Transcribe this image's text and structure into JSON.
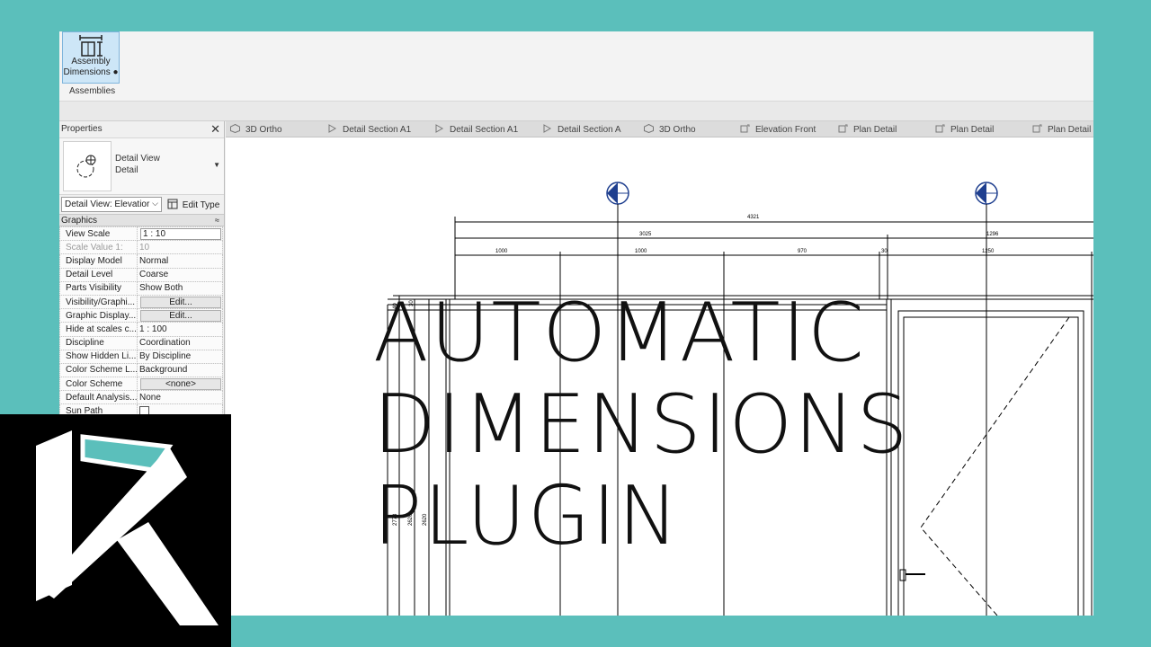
{
  "ribbon": {
    "button_line1": "Assembly",
    "button_line2": "Dimensions ●",
    "group_label": "Assemblies"
  },
  "properties": {
    "title": "Properties",
    "close": "✕",
    "type_line1": "Detail View",
    "type_line2": "Detail",
    "instance_select": "Detail View: Elevatior",
    "edit_type": "Edit Type",
    "category": "Graphics",
    "rows": [
      {
        "label": "View Scale",
        "value": "1 : 10"
      },
      {
        "label": "Scale Value    1:",
        "value": "10"
      },
      {
        "label": "Display Model",
        "value": "Normal"
      },
      {
        "label": "Detail Level",
        "value": "Coarse"
      },
      {
        "label": "Parts Visibility",
        "value": "Show Both"
      },
      {
        "label": "Visibility/Graphi...",
        "value": "Edit..."
      },
      {
        "label": "Graphic Display...",
        "value": "Edit..."
      },
      {
        "label": "Hide at scales c...",
        "value": "1 : 100"
      },
      {
        "label": "Discipline",
        "value": "Coordination"
      },
      {
        "label": "Show Hidden Li...",
        "value": "By Discipline"
      },
      {
        "label": "Color Scheme L...",
        "value": "Background"
      },
      {
        "label": "Color Scheme",
        "value": "<none>"
      },
      {
        "label": "Default Analysis...",
        "value": "None"
      },
      {
        "label": "Sun Path",
        "value": ""
      }
    ]
  },
  "tabs": [
    {
      "label": "3D Ortho",
      "icon": "3d-view-icon"
    },
    {
      "label": "Detail Section A1",
      "icon": "section-view-icon"
    },
    {
      "label": "Detail Section A1",
      "icon": "section-view-icon"
    },
    {
      "label": "Detail Section A",
      "icon": "section-view-icon"
    },
    {
      "label": "3D Ortho",
      "icon": "3d-view-icon"
    },
    {
      "label": "Elevation Front",
      "icon": "elevation-view-icon"
    },
    {
      "label": "Plan Detail",
      "icon": "plan-view-icon"
    },
    {
      "label": "Plan Detail",
      "icon": "plan-view-icon"
    },
    {
      "label": "Plan Detail",
      "icon": "plan-view-icon"
    }
  ],
  "drawing": {
    "dim_overall": "4321",
    "dim_left_total": "3025",
    "dim_right_total": "1296",
    "dim_seg1": "1000",
    "dim_seg2": "1000",
    "dim_seg3": "970",
    "dim_seg4": "30",
    "dim_seg5": "1250",
    "dim_vert1": "2773",
    "dim_vert2": "2620",
    "dim_vert3": "2620",
    "dim_top1": "30",
    "dim_top2": "40"
  },
  "headline": {
    "line1": "AUTOMATIC",
    "line2": "DIMENSIONS",
    "line3": "PLUGIN"
  },
  "colors": {
    "background": "#5bbfbb",
    "logo_accent": "#5bbfbb",
    "ribbon_highlight": "#cde6f7",
    "grid_bubble": "#1f3f8f"
  }
}
